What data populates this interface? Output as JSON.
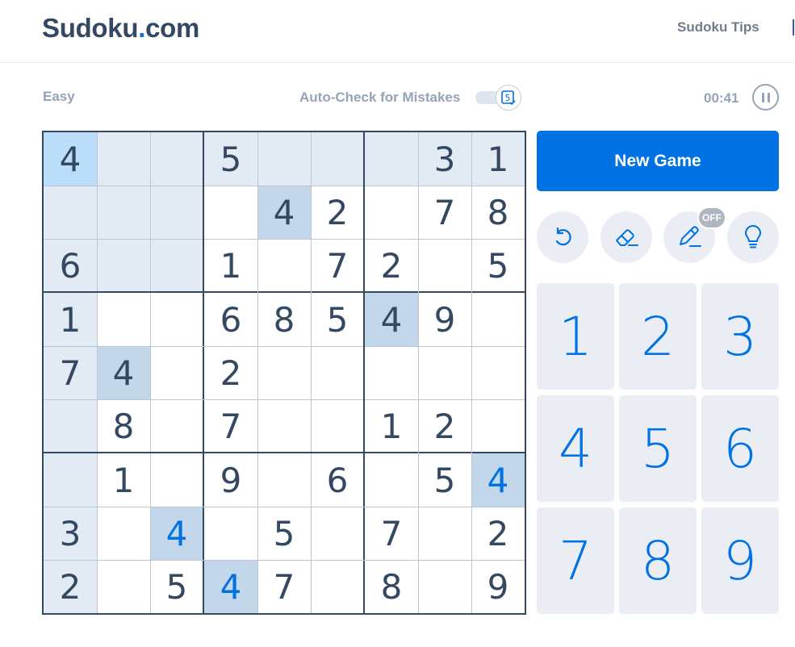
{
  "header": {
    "logo_text": "Sudoku",
    "logo_tld": "com",
    "tips_link": "Sudoku Tips"
  },
  "status_bar": {
    "difficulty": "Easy",
    "autocheck_label": "Auto-Check for Mistakes",
    "autocheck_badge": "5",
    "timer": "00:41"
  },
  "colors": {
    "accent": "#0072e3",
    "ink": "#344861",
    "selected": "#bbdefb",
    "highlight": "#e2ebf3",
    "same_number": "#c3d7ea",
    "user_digit": "#325aaf"
  },
  "board": {
    "selected": {
      "row": 0,
      "col": 0
    },
    "rows": [
      [
        "4",
        "",
        "",
        "5",
        "",
        "",
        "",
        "3",
        "1"
      ],
      [
        "",
        "",
        "",
        "",
        "4",
        "2",
        "",
        "7",
        "8"
      ],
      [
        "6",
        "",
        "",
        "1",
        "",
        "7",
        "2",
        "",
        "5"
      ],
      [
        "1",
        "",
        "",
        "6",
        "8",
        "5",
        "4",
        "9",
        ""
      ],
      [
        "7",
        "4",
        "",
        "2",
        "",
        "",
        "",
        "",
        ""
      ],
      [
        "",
        "8",
        "",
        "7",
        "",
        "",
        "1",
        "2",
        ""
      ],
      [
        "",
        "1",
        "",
        "9",
        "",
        "6",
        "",
        "5",
        "4"
      ],
      [
        "3",
        "",
        "4",
        "",
        "5",
        "",
        "7",
        "",
        "2"
      ],
      [
        "2",
        "",
        "5",
        "4",
        "7",
        "",
        "8",
        "",
        "9"
      ]
    ],
    "user_entered": [
      [
        6,
        8
      ],
      [
        7,
        2
      ],
      [
        8,
        3
      ]
    ]
  },
  "controls": {
    "new_game_label": "New Game",
    "tools": [
      {
        "name": "undo-icon"
      },
      {
        "name": "eraser-icon"
      },
      {
        "name": "pencil-notes-icon",
        "badge": "OFF"
      },
      {
        "name": "hint-lightbulb-icon"
      }
    ],
    "numpad": [
      "1",
      "2",
      "3",
      "4",
      "5",
      "6",
      "7",
      "8",
      "9"
    ]
  }
}
